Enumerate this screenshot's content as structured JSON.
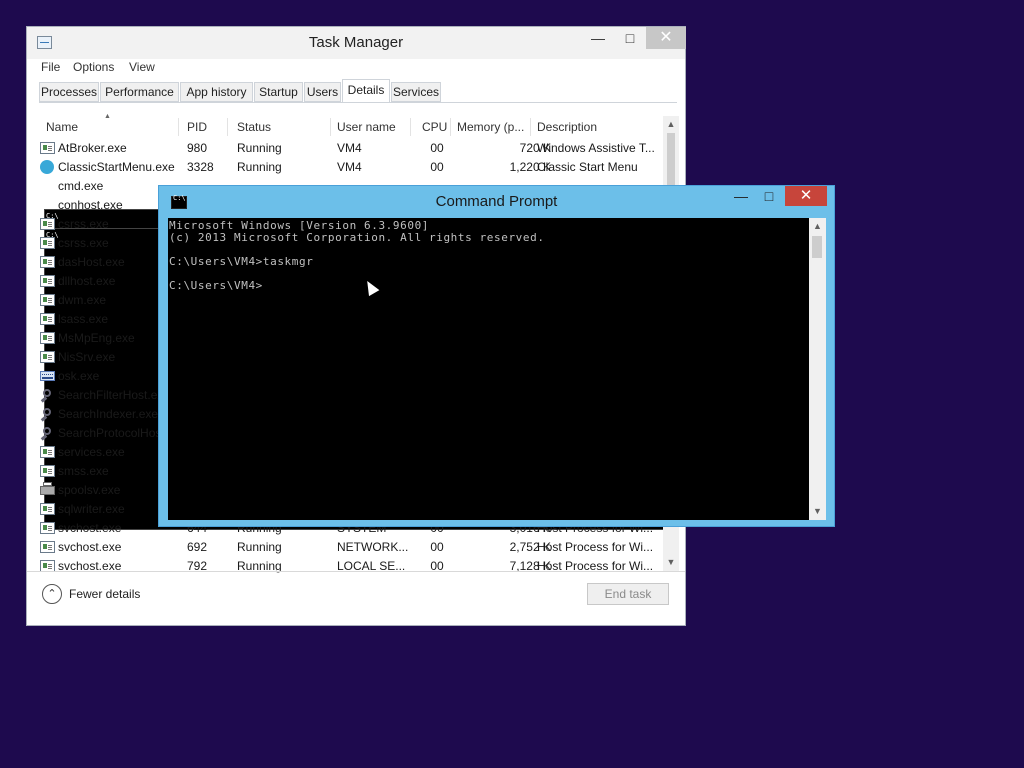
{
  "task_manager": {
    "title": "Task Manager",
    "menu": [
      "File",
      "Options",
      "View"
    ],
    "tabs": [
      "Processes",
      "Performance",
      "App history",
      "Startup",
      "Users",
      "Details",
      "Services"
    ],
    "active_tab": "Details",
    "columns": [
      "Name",
      "PID",
      "Status",
      "User name",
      "CPU",
      "Memory (p...",
      "Description"
    ],
    "rows": [
      {
        "icon": "app-window-icon",
        "name": "AtBroker.exe",
        "pid": "980",
        "status": "Running",
        "user": "VM4",
        "cpu": "00",
        "memory": "720 K",
        "description": "Windows Assistive T..."
      },
      {
        "icon": "globe-icon",
        "name": "ClassicStartMenu.exe",
        "pid": "3328",
        "status": "Running",
        "user": "VM4",
        "cpu": "00",
        "memory": "1,220 K",
        "description": "Classic Start Menu"
      },
      {
        "icon": "console-icon",
        "name": "cmd.exe",
        "pid": "",
        "status": "",
        "user": "",
        "cpu": "",
        "memory": "",
        "description": ""
      },
      {
        "icon": "console-icon",
        "name": "conhost.exe",
        "pid": "",
        "status": "",
        "user": "",
        "cpu": "",
        "memory": "",
        "description": ""
      },
      {
        "icon": "app-window-icon",
        "name": "csrss.exe",
        "pid": "",
        "status": "",
        "user": "",
        "cpu": "",
        "memory": "",
        "description": ""
      },
      {
        "icon": "app-window-icon",
        "name": "csrss.exe",
        "pid": "",
        "status": "",
        "user": "",
        "cpu": "",
        "memory": "",
        "description": ""
      },
      {
        "icon": "app-window-icon",
        "name": "dasHost.exe",
        "pid": "",
        "status": "",
        "user": "",
        "cpu": "",
        "memory": "",
        "description": ""
      },
      {
        "icon": "app-window-icon",
        "name": "dllhost.exe",
        "pid": "",
        "status": "",
        "user": "",
        "cpu": "",
        "memory": "",
        "description": ""
      },
      {
        "icon": "app-window-icon",
        "name": "dwm.exe",
        "pid": "",
        "status": "",
        "user": "",
        "cpu": "",
        "memory": "",
        "description": ""
      },
      {
        "icon": "app-window-icon",
        "name": "lsass.exe",
        "pid": "",
        "status": "",
        "user": "",
        "cpu": "",
        "memory": "",
        "description": ""
      },
      {
        "icon": "app-window-icon",
        "name": "MsMpEng.exe",
        "pid": "",
        "status": "",
        "user": "",
        "cpu": "",
        "memory": "",
        "description": ""
      },
      {
        "icon": "app-window-icon",
        "name": "NisSrv.exe",
        "pid": "",
        "status": "",
        "user": "",
        "cpu": "",
        "memory": "",
        "description": ""
      },
      {
        "icon": "keyboard-icon",
        "name": "osk.exe",
        "pid": "",
        "status": "",
        "user": "",
        "cpu": "",
        "memory": "",
        "description": ""
      },
      {
        "icon": "search-icon",
        "name": "SearchFilterHost.exe",
        "pid": "",
        "status": "",
        "user": "",
        "cpu": "",
        "memory": "",
        "description": ""
      },
      {
        "icon": "search-icon",
        "name": "SearchIndexer.exe",
        "pid": "",
        "status": "",
        "user": "",
        "cpu": "",
        "memory": "",
        "description": ""
      },
      {
        "icon": "search-icon",
        "name": "SearchProtocolHost.exe",
        "pid": "",
        "status": "",
        "user": "",
        "cpu": "",
        "memory": "",
        "description": ""
      },
      {
        "icon": "app-window-icon",
        "name": "services.exe",
        "pid": "",
        "status": "",
        "user": "",
        "cpu": "",
        "memory": "",
        "description": ""
      },
      {
        "icon": "app-window-icon",
        "name": "smss.exe",
        "pid": "",
        "status": "",
        "user": "",
        "cpu": "",
        "memory": "",
        "description": ""
      },
      {
        "icon": "printer-icon",
        "name": "spoolsv.exe",
        "pid": "",
        "status": "",
        "user": "",
        "cpu": "",
        "memory": "",
        "description": ""
      },
      {
        "icon": "app-window-icon",
        "name": "sqlwriter.exe",
        "pid": "",
        "status": "",
        "user": "",
        "cpu": "",
        "memory": "",
        "description": ""
      },
      {
        "icon": "app-window-icon",
        "name": "svchost.exe",
        "pid": "644",
        "status": "Running",
        "user": "SYSTEM",
        "cpu": "00",
        "memory": "3,016 K",
        "description": "Host Process for Wi..."
      },
      {
        "icon": "app-window-icon",
        "name": "svchost.exe",
        "pid": "692",
        "status": "Running",
        "user": "NETWORK...",
        "cpu": "00",
        "memory": "2,752 K",
        "description": "Host Process for Wi..."
      },
      {
        "icon": "app-window-icon",
        "name": "svchost.exe",
        "pid": "792",
        "status": "Running",
        "user": "LOCAL SE...",
        "cpu": "00",
        "memory": "7,128 K",
        "description": "Host Process for Wi..."
      }
    ],
    "fewer_details": "Fewer details",
    "end_task": "End task"
  },
  "command_prompt": {
    "title": "Command Prompt",
    "lines": [
      "Microsoft Windows [Version 6.3.9600]",
      "(c) 2013 Microsoft Corporation. All rights reserved.",
      "",
      "C:\\Users\\VM4>taskmgr",
      "",
      "C:\\Users\\VM4>"
    ]
  },
  "colors": {
    "desktop": "#1e0a4e",
    "cmd_frame": "#6cbfe9",
    "close_red": "#c7453b"
  }
}
